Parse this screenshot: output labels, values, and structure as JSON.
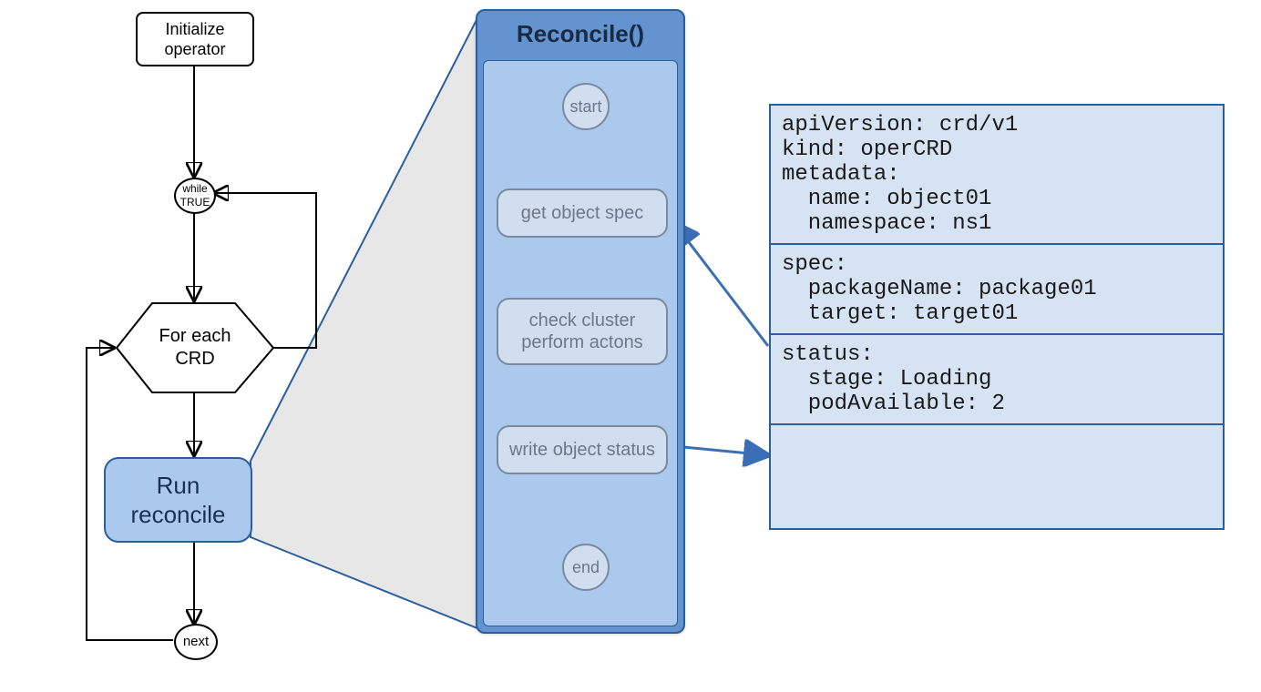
{
  "flow": {
    "initialize": "Initialize\noperator",
    "while": "while\nTRUE",
    "foreach": "For each\nCRD",
    "run_reconcile": "Run\nreconcile",
    "next": "next"
  },
  "panel": {
    "title": "Reconcile()",
    "start": "start",
    "get_spec": "get object spec",
    "check_cluster": "check cluster\nperform actons",
    "write_status": "write object status",
    "end": "end"
  },
  "yaml": {
    "header": [
      "apiVersion: crd/v1",
      "kind: operCRD",
      "metadata:",
      "  name: object01",
      "  namespace: ns1"
    ],
    "spec": [
      "spec:",
      "  packageName: package01",
      "  target: target01"
    ],
    "status": [
      "status:",
      "  stage: Loading",
      "  podAvailable: 2"
    ]
  }
}
